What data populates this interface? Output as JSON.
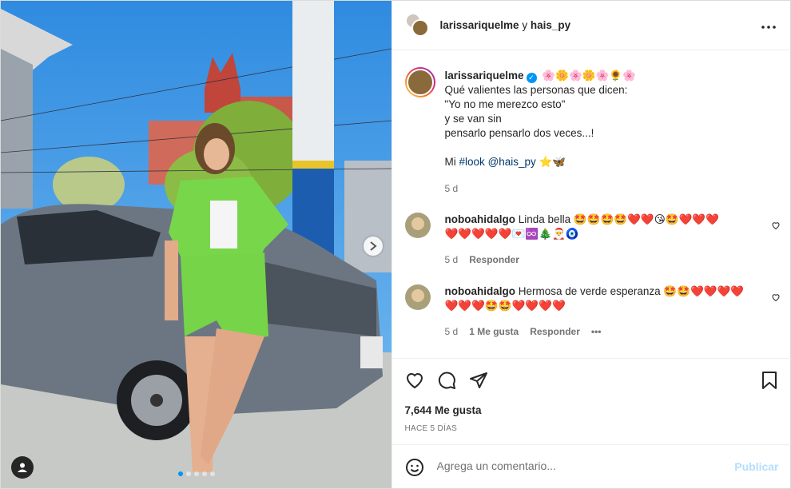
{
  "header": {
    "user1": "larissariquelme",
    "connector": "y",
    "user2": "hais_py",
    "more_icon": "more-horizontal-icon"
  },
  "caption": {
    "username": "larissariquelme",
    "verified_icon": "verified-badge-icon",
    "emojis": "🌸🌼🌸🌼🌸🌻🌸",
    "lines": [
      "Qué valientes las personas que dicen:",
      "\"Yo no me merezco esto\"",
      "y se van sin",
      "pensarlo pensarlo dos veces...!"
    ],
    "line5_prefix": "Mi",
    "hashtag": "#look",
    "mention": "@hais_py",
    "line5_suffix": "⭐🦋",
    "time": "5 d"
  },
  "comments": [
    {
      "username": "noboahidalgo",
      "text": "Linda bella",
      "emojis_line1": "🤩🤩🤩🤩❤️❤️😘🤩❤️❤️❤️",
      "emojis_line2": "❤️❤️❤️❤️❤️💌♾️🎄🎅🧿",
      "time": "5 d",
      "reply": "Responder"
    },
    {
      "username": "noboahidalgo",
      "text": "Hermosa de verde esperanza",
      "emojis_line1": "🤩🤩❤️❤️❤️❤️",
      "emojis_line2": "❤️❤️❤️🤩🤩❤️❤️❤️❤️",
      "time": "5 d",
      "likes": "1 Me gusta",
      "reply": "Responder",
      "more": "•••"
    }
  ],
  "actions": {
    "like_icon": "heart-icon",
    "comment_icon": "comment-icon",
    "share_icon": "paper-plane-icon",
    "save_icon": "bookmark-icon"
  },
  "likes_text": "7,644 Me gusta",
  "date_text": "HACE 5 DÍAS",
  "comment_input": {
    "placeholder": "Agrega un comentario...",
    "publish": "Publicar",
    "emoji_icon": "smiley-icon"
  },
  "carousel": {
    "total": 5,
    "active": 1,
    "next_icon": "chevron-right-icon",
    "tag_icon": "user-tag-icon"
  },
  "colors": {
    "accent": "#0095f6",
    "publish_disabled": "#b2dffc",
    "link": "#00376b",
    "secondary_text": "#737373"
  }
}
